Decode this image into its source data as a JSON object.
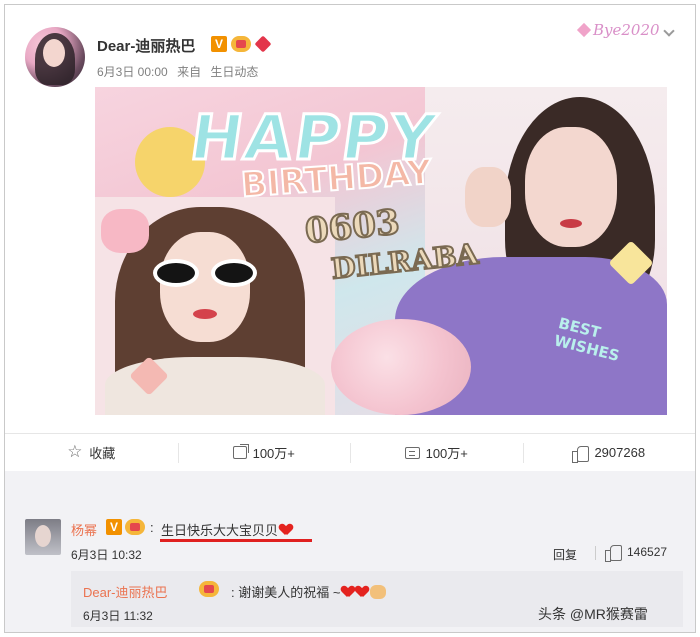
{
  "post": {
    "author": "Dear-迪丽热巴",
    "verified_badge": "V",
    "date": "6月3日 00:00",
    "source_prefix": "来自",
    "source": "生日动态",
    "top_badge": "Bye2020"
  },
  "image": {
    "happy_text": "HAPPY",
    "birthday_text": "BIRTHDAY",
    "date_text": "0603",
    "name_text": "DILRABA",
    "best_wishes_text": "BEST WISHES"
  },
  "actions": {
    "favorite_label": "收藏",
    "repost_count": "100万+",
    "comment_count": "100万+",
    "like_count": "2907268"
  },
  "comment": {
    "author": "杨幂",
    "verified_badge": "V",
    "colon": ":",
    "text": "生日快乐大大宝贝贝",
    "time": "6月3日 10:32",
    "reply_label": "回复",
    "like_count": "146527"
  },
  "reply": {
    "author": "Dear-迪丽热巴",
    "colon": ":",
    "text": "谢谢美人的祝福 ~",
    "time": "6月3日 11:32"
  },
  "watermark": "头条 @MR猴赛雷",
  "colors": {
    "name_orange": "#eb7350",
    "verified_orange": "#f29100",
    "highlight_red": "#e02020",
    "comment_bg": "#f2f2f5"
  }
}
